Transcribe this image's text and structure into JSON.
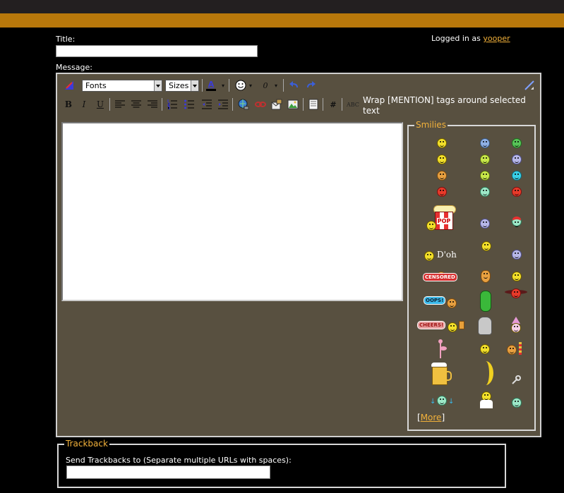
{
  "header": {
    "logged_in_prefix": "Logged in as",
    "username": "yooper"
  },
  "form": {
    "title_label": "Title:",
    "title_value": "",
    "message_label": "Message:",
    "message_value": ""
  },
  "toolbar": {
    "font_select": "Fonts",
    "size_select": "Sizes",
    "bold": "B",
    "italic": "I",
    "underline": "U",
    "mention_hint": "Wrap [MENTION] tags around selected text",
    "abc": "ABC",
    "hash": "#",
    "attach": "0",
    "text_color": "A"
  },
  "smilies": {
    "legend": "Smilies",
    "doh_text": "D'oh",
    "censored_tag": "CENSORED",
    "oops_tag": "OOPS!",
    "cheers_tag": "CHEERS!",
    "popcorn": "POP",
    "more_label": "More",
    "more_bracket_open": "[",
    "more_bracket_close": "]"
  },
  "trackback": {
    "legend": "Trackback",
    "label": "Send Trackbacks to (Separate multiple URLs with spaces):",
    "value": ""
  },
  "colors": {
    "top_bar": "#231f20",
    "orange_bar": "#b8780b",
    "editor_bg": "#585040",
    "accent": "#f2b13a"
  }
}
